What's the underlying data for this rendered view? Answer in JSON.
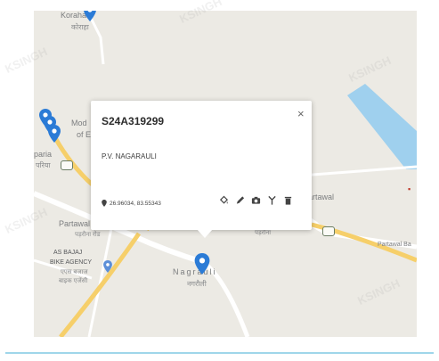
{
  "map": {
    "labels": {
      "koraha_en": "Koraha",
      "koraha_hi": "कोराहा",
      "mod_1": "Mod",
      "mod_2": "of E",
      "paria_en": "paria",
      "paria_hi": "परिया",
      "partawal_left_en": "Partawal",
      "partawal_left_hi": "पड़रौना रोड",
      "partawal_right": "Partawal",
      "hindi_right": "पड़रौना",
      "partawal_road": "Partawal Ba",
      "bike_1": "AS BAJAJ",
      "bike_2": "BIKE AGENCY",
      "bike_3": "एएस बजाज",
      "bike_4": "बाइक एजेंसी",
      "nagrauli_en": "Nagrauli",
      "nagrauli_hi": "नगरौली"
    },
    "colors": {
      "land": "#eceae4",
      "road_primary": "#f6cf6a",
      "road_minor": "#ffffff",
      "water": "#9fd0ee",
      "pin": "#2b7bd6"
    }
  },
  "popup": {
    "title": "S24A319299",
    "subtitle": "P.V. NAGARAULI",
    "coordinates": "26.96034, 83.55343",
    "close_glyph": "×",
    "actions": [
      "paint-bucket-icon",
      "pencil-icon",
      "camera-icon",
      "route-icon",
      "trash-icon"
    ]
  },
  "watermark": "KSINGH"
}
